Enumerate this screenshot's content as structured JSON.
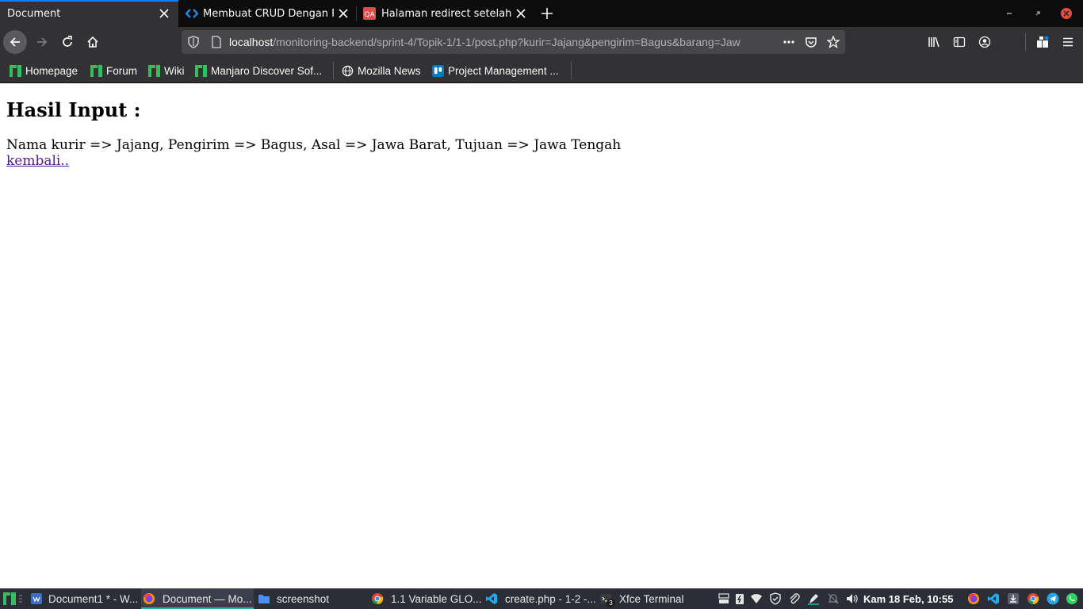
{
  "browser": {
    "tabs": [
      {
        "title": "Document",
        "active": true
      },
      {
        "title": "Membuat CRUD Dengan P",
        "active": false
      },
      {
        "title": "Halaman redirect setelah",
        "active": false
      }
    ],
    "url": {
      "host": "localhost",
      "path": "/monitoring-backend/sprint-4/Topik-1/1-1/post.php?kurir=Jajang&pengirim=Bagus&barang=Jaw"
    },
    "bookmarks": [
      {
        "label": "Homepage"
      },
      {
        "label": "Forum"
      },
      {
        "label": "Wiki"
      },
      {
        "label": "Manjaro Discover Sof..."
      },
      {
        "label": "Mozilla News"
      },
      {
        "label": "Project Management ..."
      }
    ]
  },
  "page": {
    "heading": "Hasil Input :",
    "result": "Nama kurir => Jajang, Pengirim => Bagus, Asal => Jawa Barat, Tujuan => Jawa Tengah",
    "back_link": "kembali.."
  },
  "taskbar": {
    "items": [
      {
        "label": "Document1 * - W..."
      },
      {
        "label": "Document — Mo..."
      },
      {
        "label": "screenshot"
      },
      {
        "label": "1.1 Variable GLO..."
      },
      {
        "label": "create.php - 1-2 -..."
      },
      {
        "label": "Xfce Terminal"
      }
    ],
    "terminal_badge": "3",
    "clock": "Kam 18 Feb, 10:55"
  },
  "colors": {
    "accent": "#0a84ff",
    "manjaro_green": "#35bf5c",
    "link_visited": "#551a8b",
    "taskbar_accent": "#1abc9c"
  }
}
